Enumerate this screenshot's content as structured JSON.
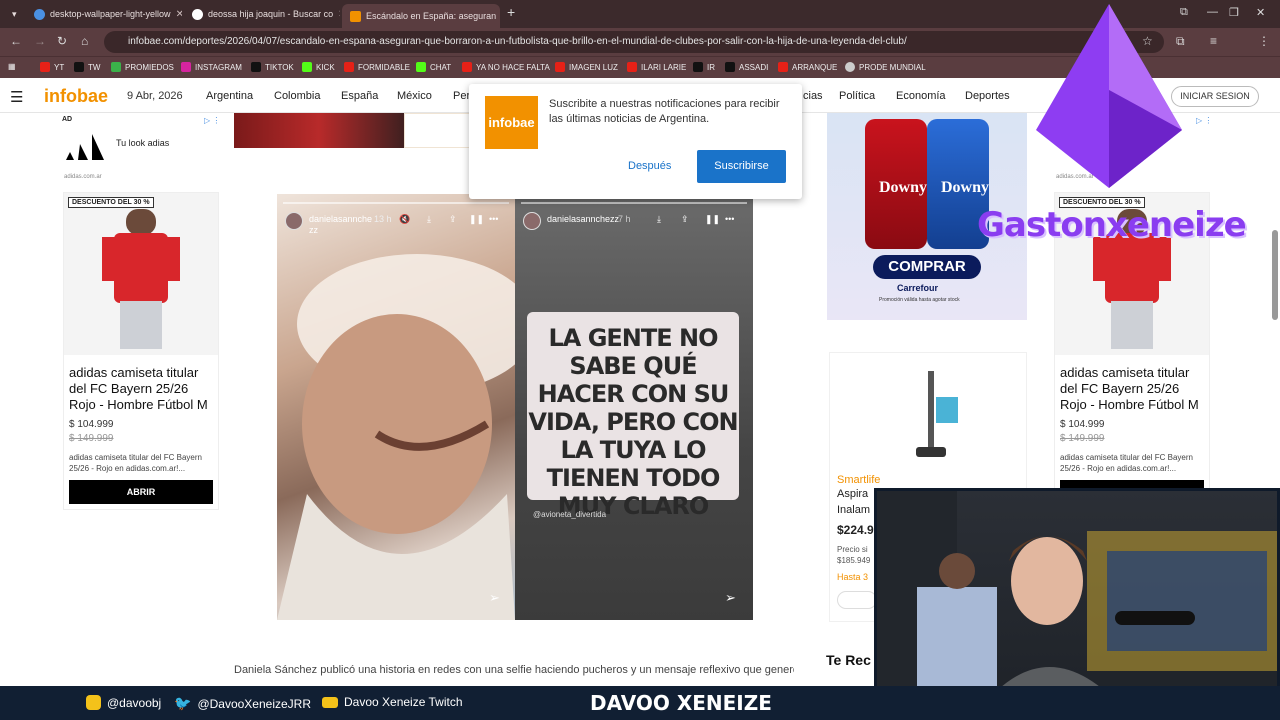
{
  "browser": {
    "tabs": [
      {
        "title": "desktop-wallpaper-light-yellow",
        "color": "#4a90e2"
      },
      {
        "title": "deossa hija joaquin - Buscar co",
        "color": "#ffffff"
      },
      {
        "title": "Escándalo en España: aseguran",
        "color": "#f29100"
      }
    ],
    "url": "infobae.com/deportes/2026/04/07/escandalo-en-espana-aseguran-que-borraron-a-un-futbolista-que-brillo-en-el-mundial-de-clubes-por-salir-con-la-hija-de-una-leyenda-del-club/",
    "bookmarks": [
      "YT",
      "TW",
      "PROMIEDOS",
      "INSTAGRAM",
      "TIKTOK",
      "KICK",
      "FORMIDABLE",
      "CHAT",
      "YA NO HACE FALTA",
      "IMAGEN LUZ",
      "ILARI LARIE",
      "IR",
      "ASSADI",
      "ARRANQUE",
      "PRODE MUNDIAL"
    ]
  },
  "site": {
    "logo": "infobae",
    "date": "9 Abr, 2026",
    "nav": [
      "Argentina",
      "Colombia",
      "España",
      "México",
      "Per",
      "cias",
      "Política",
      "Economía",
      "Deportes"
    ],
    "login": "INICIAR SESION"
  },
  "popup": {
    "logo": "infobae",
    "text": "Suscribite a nuestras notificaciones para recibir las últimas noticias de Argentina.",
    "later": "Después",
    "subscribe": "Suscribirse"
  },
  "ad_left": {
    "ad_label": "AD",
    "slogan": "Tu look adias",
    "domain": "adidas.com.ar",
    "badge": "DESCUENTO DEL 30 %",
    "title": "adidas camiseta titular del FC Bayern 25/26 Rojo - Hombre Fútbol M",
    "price": "$ 104.999",
    "old_price": "$ 149.999",
    "desc": "adidas camiseta titular del FC Bayern 25/26 - Rojo en adidas.com.ar!...",
    "cta": "ABRIR"
  },
  "ad_right": {
    "domain": "adidas.com.ar",
    "badge": "DESCUENTO DEL 30 %",
    "title": "adidas camiseta titular del FC Bayern 25/26 Rojo - Hombre Fútbol M",
    "price": "$ 104.999",
    "old_price": "$ 149.999",
    "desc": "adidas camiseta titular del FC Bayern 25/26 - Rojo en adidas.com.ar!...",
    "cta": "ABRIR"
  },
  "downy_ad": {
    "brand1": "Downy",
    "brand2": "Downy",
    "cta": "COMPRAR",
    "store": "Carrefour",
    "note": "Promoción válida hasta agotar stock"
  },
  "smartlife_ad": {
    "brand": "Smartlife",
    "title1": "Aspira",
    "title2": "Inalam",
    "price": "$224.9",
    "small1": "Precio si",
    "small2": "$185.949",
    "small3": "Hasta 3"
  },
  "stories": {
    "left": {
      "user": "danielasannche zz",
      "time": "13 h"
    },
    "right": {
      "user": "danielasannchezz",
      "time": "7 h",
      "quote": "LA GENTE NO SABE QUÉ HACER CON SU VIDA, PERO CON LA TUYA LO TIENEN TODO MUY CLARO",
      "tag": "@avioneta_divertida"
    }
  },
  "article": {
    "text": "Daniela Sánchez publicó una historia en redes con una selfie haciendo pucheros y un mensaje reflexivo que generó"
  },
  "sidebar": {
    "heading": "Te Rec"
  },
  "overlay": {
    "watermark": "Gastonxeneize",
    "footer": {
      "instagram": "@davoobj",
      "twitter": "@DavooXeneizeJRR",
      "twitch": "Davoo Xeneize Twitch",
      "brand": "DAVOO XENEIZE"
    }
  }
}
